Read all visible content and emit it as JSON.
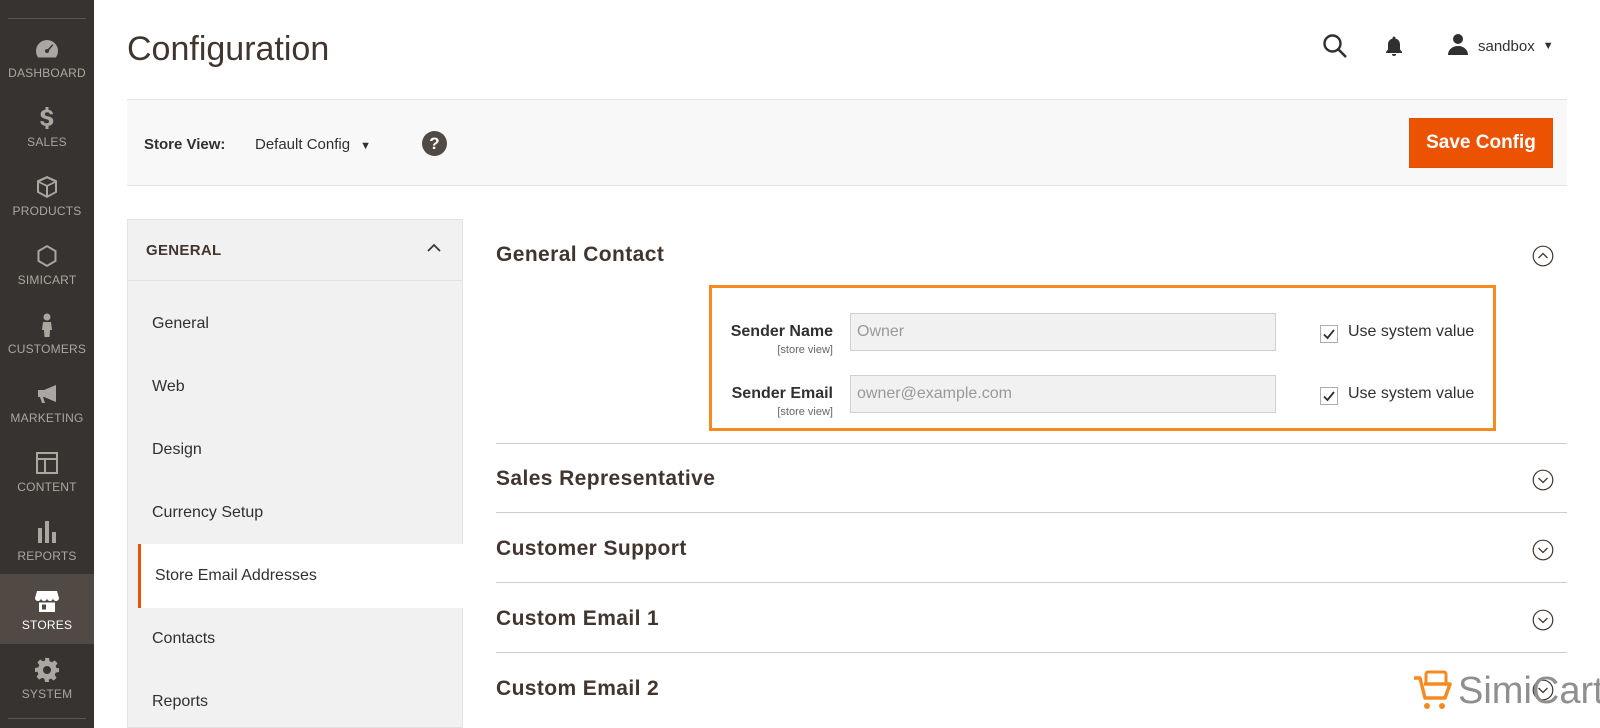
{
  "nav": {
    "items": [
      {
        "label": "DASHBOARD",
        "icon": "dashboard-icon"
      },
      {
        "label": "SALES",
        "icon": "dollar-icon"
      },
      {
        "label": "PRODUCTS",
        "icon": "cube-icon"
      },
      {
        "label": "SIMICART",
        "icon": "hexagon-icon"
      },
      {
        "label": "CUSTOMERS",
        "icon": "person-icon"
      },
      {
        "label": "MARKETING",
        "icon": "megaphone-icon"
      },
      {
        "label": "CONTENT",
        "icon": "layout-icon"
      },
      {
        "label": "REPORTS",
        "icon": "bar-chart-icon"
      },
      {
        "label": "STORES",
        "icon": "storefront-icon"
      },
      {
        "label": "SYSTEM",
        "icon": "gear-icon"
      }
    ],
    "active": "STORES"
  },
  "header": {
    "title": "Configuration",
    "user": "sandbox"
  },
  "storebar": {
    "label": "Store View:",
    "selected": "Default Config",
    "help": "?",
    "save_label": "Save Config"
  },
  "sidebar": {
    "group": "GENERAL",
    "items": [
      {
        "label": "General"
      },
      {
        "label": "Web"
      },
      {
        "label": "Design"
      },
      {
        "label": "Currency Setup"
      },
      {
        "label": "Store Email Addresses"
      },
      {
        "label": "Contacts"
      },
      {
        "label": "Reports"
      }
    ],
    "active": "Store Email Addresses"
  },
  "sections": [
    {
      "title": "General Contact",
      "expanded": true
    },
    {
      "title": "Sales Representative",
      "expanded": false
    },
    {
      "title": "Customer Support",
      "expanded": false
    },
    {
      "title": "Custom Email 1",
      "expanded": false
    },
    {
      "title": "Custom Email 2",
      "expanded": false
    }
  ],
  "fields": [
    {
      "label": "Sender Name",
      "scope": "[store view]",
      "value": "Owner",
      "checkbox_label": "Use system value",
      "checked": true
    },
    {
      "label": "Sender Email",
      "scope": "[store view]",
      "value": "owner@example.com",
      "checkbox_label": "Use system value",
      "checked": true
    }
  ],
  "watermark": {
    "brand": "SimiCart"
  },
  "colors": {
    "accent": "#eb5202",
    "highlight": "#f58b20",
    "nav_bg": "#373330"
  }
}
